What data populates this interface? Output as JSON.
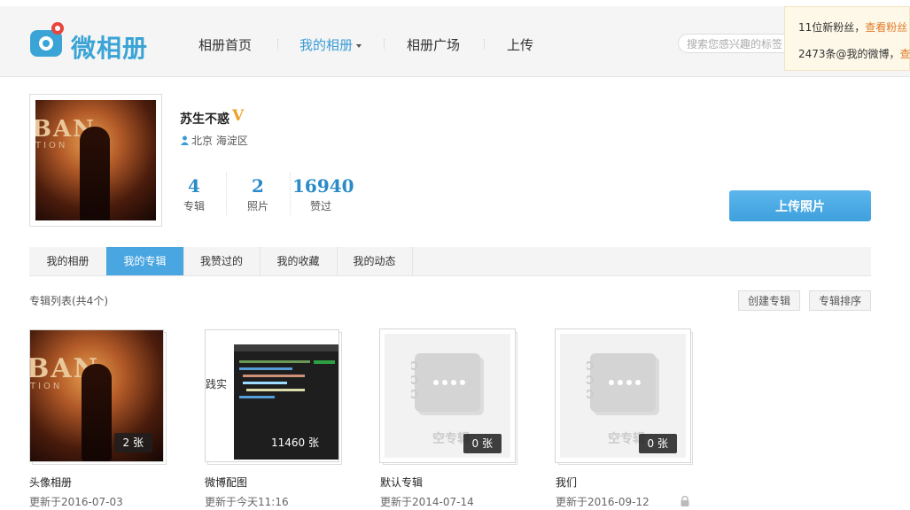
{
  "header": {
    "logo_text": "微相册",
    "nav": [
      {
        "label": "相册首页"
      },
      {
        "label": "我的相册"
      },
      {
        "label": "相册广场"
      },
      {
        "label": "上传"
      }
    ],
    "search_placeholder": "搜索您感兴趣的标签",
    "notifications": {
      "line1_prefix": "11位新粉丝，",
      "line1_link": "查看粉丝",
      "line2_prefix": "2473条@我的微博，",
      "line2_link": "查看"
    }
  },
  "profile": {
    "avatar_poster_title": "BAN",
    "avatar_poster_sub": "TION",
    "name": "苏生不惑",
    "verified_badge": "V",
    "location": "北京 海淀区",
    "stats": [
      {
        "num": "4",
        "label": "专辑"
      },
      {
        "num": "2",
        "label": "照片"
      },
      {
        "num": "16940",
        "label": "赞过"
      }
    ],
    "upload_button": "上传照片"
  },
  "tabs": [
    {
      "label": "我的相册"
    },
    {
      "label": "我的专辑"
    },
    {
      "label": "我赞过的"
    },
    {
      "label": "我的收藏"
    },
    {
      "label": "我的动态"
    }
  ],
  "album_list": {
    "title": "专辑列表(共4个)",
    "create_button": "创建专辑",
    "sort_button": "专辑排序",
    "empty_label": "空专辑",
    "albums": [
      {
        "name": "头像相册",
        "count": "2 张",
        "date": "更新于2016-07-03"
      },
      {
        "name": "微博配图",
        "count": "11460 张",
        "date": "更新于今天11:16",
        "cover_text": "践实"
      },
      {
        "name": "默认专辑",
        "count": "0 张",
        "date": "更新于2014-07-14"
      },
      {
        "name": "我们",
        "count": "0 张",
        "date": "更新于2016-09-12"
      }
    ]
  },
  "colors": {
    "accent": "#3a9cd6",
    "tab_active": "#4aa6e0",
    "link_orange": "#e07b2a"
  }
}
